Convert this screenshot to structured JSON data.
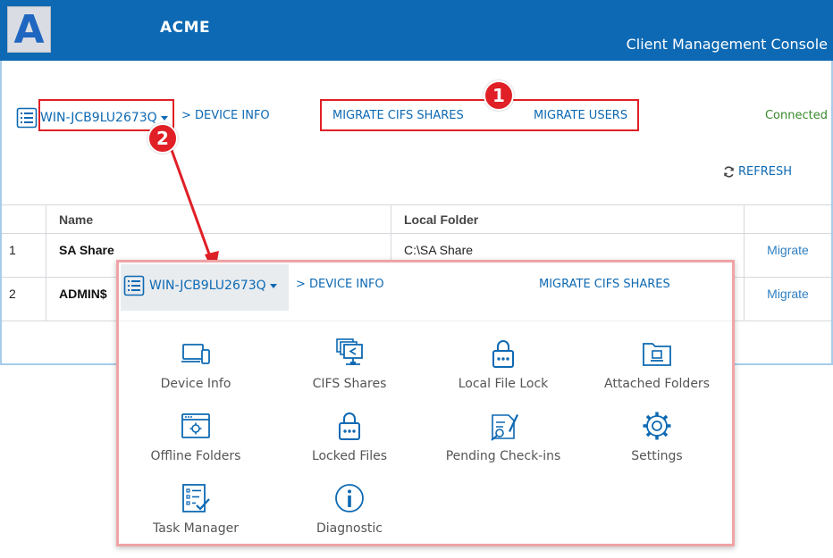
{
  "header": {
    "logo_letter": "A",
    "brand": "ACME",
    "console_title": "Client Management Console"
  },
  "toolbar": {
    "device_name": "WIN-JCB9LU2673Q",
    "device_info": "> DEVICE INFO",
    "migrate_cifs": "MIGRATE CIFS SHARES",
    "migrate_users": "MIGRATE USERS",
    "status": "Connected",
    "refresh": "REFRESH"
  },
  "table": {
    "columns": [
      "",
      "Name",
      "Local Folder",
      ""
    ],
    "rows": [
      {
        "index": "1",
        "name": "SA Share",
        "folder": "C:\\SA Share",
        "action": "Migrate"
      },
      {
        "index": "2",
        "name": "ADMIN$",
        "folder": "",
        "action": "Migrate"
      }
    ]
  },
  "annotations": {
    "badge1": "1",
    "badge2": "2"
  },
  "popup": {
    "device_name": "WIN-JCB9LU2673Q",
    "device_info": "> DEVICE INFO",
    "migrate_cifs": "MIGRATE CIFS SHARES",
    "tiles": [
      {
        "label": "Device Info",
        "icon": "device-info-icon"
      },
      {
        "label": "CIFS Shares",
        "icon": "cifs-shares-icon"
      },
      {
        "label": "Local File Lock",
        "icon": "local-file-lock-icon"
      },
      {
        "label": "Attached Folders",
        "icon": "attached-folders-icon"
      },
      {
        "label": "Offline Folders",
        "icon": "offline-folders-icon"
      },
      {
        "label": "Locked Files",
        "icon": "locked-files-icon"
      },
      {
        "label": "Pending Check-ins",
        "icon": "pending-checkins-icon"
      },
      {
        "label": "Settings",
        "icon": "settings-icon"
      },
      {
        "label": "Task Manager",
        "icon": "task-manager-icon"
      },
      {
        "label": "Diagnostic",
        "icon": "diagnostic-icon"
      }
    ]
  },
  "colors": {
    "brand_blue": "#0d69b3",
    "callout_red": "#e01f26",
    "status_green": "#3a8a2e"
  }
}
